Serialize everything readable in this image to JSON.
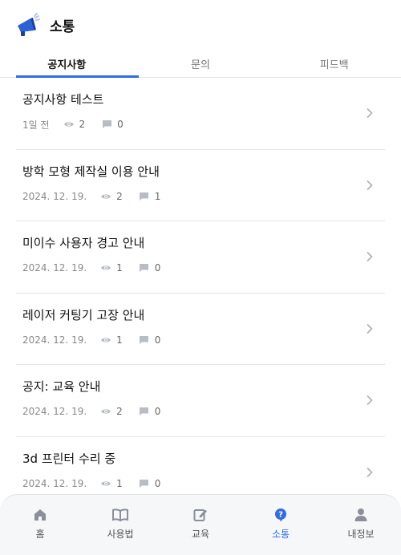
{
  "header": {
    "title": "소통"
  },
  "tabs": [
    {
      "label": "공지사항",
      "active": true
    },
    {
      "label": "문의",
      "active": false
    },
    {
      "label": "피드백",
      "active": false
    }
  ],
  "posts": [
    {
      "title": "공지사항 테스트",
      "date": "1일 전",
      "views": "2",
      "comments": "0"
    },
    {
      "title": "방학 모형 제작실 이용 안내",
      "date": "2024. 12. 19.",
      "views": "2",
      "comments": "1"
    },
    {
      "title": "미이수 사용자 경고 안내",
      "date": "2024. 12. 19.",
      "views": "1",
      "comments": "0"
    },
    {
      "title": "레이저 커팅기 고장 안내",
      "date": "2024. 12. 19.",
      "views": "1",
      "comments": "0"
    },
    {
      "title": "공지: 교육 안내",
      "date": "2024. 12. 19.",
      "views": "2",
      "comments": "0"
    },
    {
      "title": "3d 프린터 수리 중",
      "date": "2024. 12. 19.",
      "views": "1",
      "comments": "0"
    }
  ],
  "nav": [
    {
      "label": "홈",
      "icon": "home-icon",
      "active": false
    },
    {
      "label": "사용법",
      "icon": "book-icon",
      "active": false
    },
    {
      "label": "교육",
      "icon": "edit-icon",
      "active": false
    },
    {
      "label": "소통",
      "icon": "question-icon",
      "active": true
    },
    {
      "label": "내정보",
      "icon": "person-icon",
      "active": false
    }
  ],
  "colors": {
    "accent": "#2f6de4",
    "divider": "#e4e4e4",
    "meta": "#888888"
  }
}
